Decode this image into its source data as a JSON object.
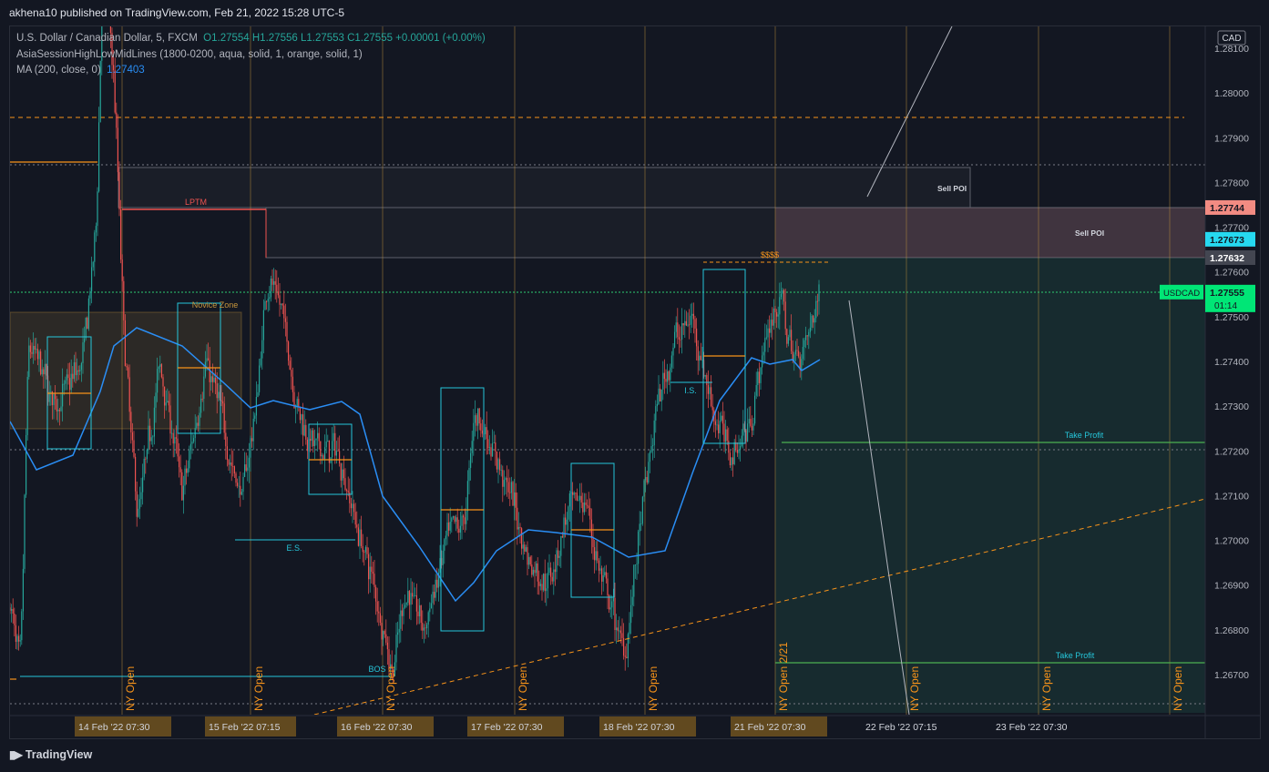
{
  "header": {
    "published": "akhena10 published on TradingView.com, Feb 21, 2022 15:28 UTC-5"
  },
  "legend": {
    "symbol": "U.S. Dollar / Canadian Dollar, 5, FXCM",
    "ohlc": "O1.27554  H1.27556  L1.27553  C1.27555  +0.00001 (+0.00%)",
    "indicator1": "AsiaSessionHighLowMidLines (1800-0200, aqua, solid, 1, orange, solid, 1)",
    "indicator2_name": "MA (200, close, 0)",
    "indicator2_value": "1.27403"
  },
  "footer": {
    "brand": "TradingView"
  },
  "colors": {
    "background": "#131722",
    "up": "#26a69a",
    "down": "#ef5350",
    "ma": "#2a8ef5",
    "session_box": "#26c6da",
    "session_line": "#f7931a",
    "take_profit": "#4caf50",
    "price_badge": "#00e676"
  },
  "chart_data": {
    "type": "candlestick",
    "currency": "CAD",
    "symbol_badge": "USDCAD",
    "countdown": "01:14",
    "y_ticks": [
      "1.28100",
      "1.28000",
      "1.27900",
      "1.27800",
      "1.27700",
      "1.27600",
      "1.27500",
      "1.27400",
      "1.27300",
      "1.27200",
      "1.27100",
      "1.27000",
      "1.26900",
      "1.26800",
      "1.26700"
    ],
    "ylim": [
      1.2662,
      1.2813
    ],
    "price_labels": [
      {
        "value": "1.27744",
        "price": 1.27744,
        "color": "#f28b82"
      },
      {
        "value": "1.27673",
        "price": 1.27673,
        "color": "#26d9f0"
      },
      {
        "value": "1.27632",
        "price": 1.27632,
        "color": "#434651"
      },
      {
        "value": "1.27555",
        "price": 1.27555,
        "color": "#00e676"
      }
    ],
    "x_labels": [
      "14 Feb '22   07:30",
      "15 Feb '22   07:15",
      "16 Feb '22   07:30",
      "17 Feb '22   07:30",
      "18 Feb '22   07:30",
      "21 Feb '22   07:30",
      "22 Feb '22   07:15",
      "23 Feb '22   07:30"
    ],
    "day_boundaries": [
      "14 Feb",
      "15 Feb",
      "16 Feb",
      "17 Feb",
      "18 Feb",
      "21 Feb",
      "22 Feb",
      "23 Feb"
    ],
    "session_labels": [
      "NY Open",
      "NY Open",
      "NY Open",
      "NY Open",
      "NY Open",
      "NY Open 2/21",
      "NY Open",
      "NY Open",
      "NY Open"
    ],
    "zones": [
      {
        "label": "Sell POI",
        "top": 1.2784,
        "bottom": 1.2775
      },
      {
        "label": "Sell POI",
        "top": 1.2775,
        "bottom": 1.2764
      }
    ],
    "annotations": [
      "LPTM",
      "Novice Zone",
      "E.S.",
      "BOS",
      "I.S.",
      "$$$$",
      "Take Profit",
      "Take Profit"
    ],
    "take_profit_levels": [
      1.2722,
      1.2673
    ],
    "ma_last": 1.27403,
    "last_price": 1.27555
  }
}
